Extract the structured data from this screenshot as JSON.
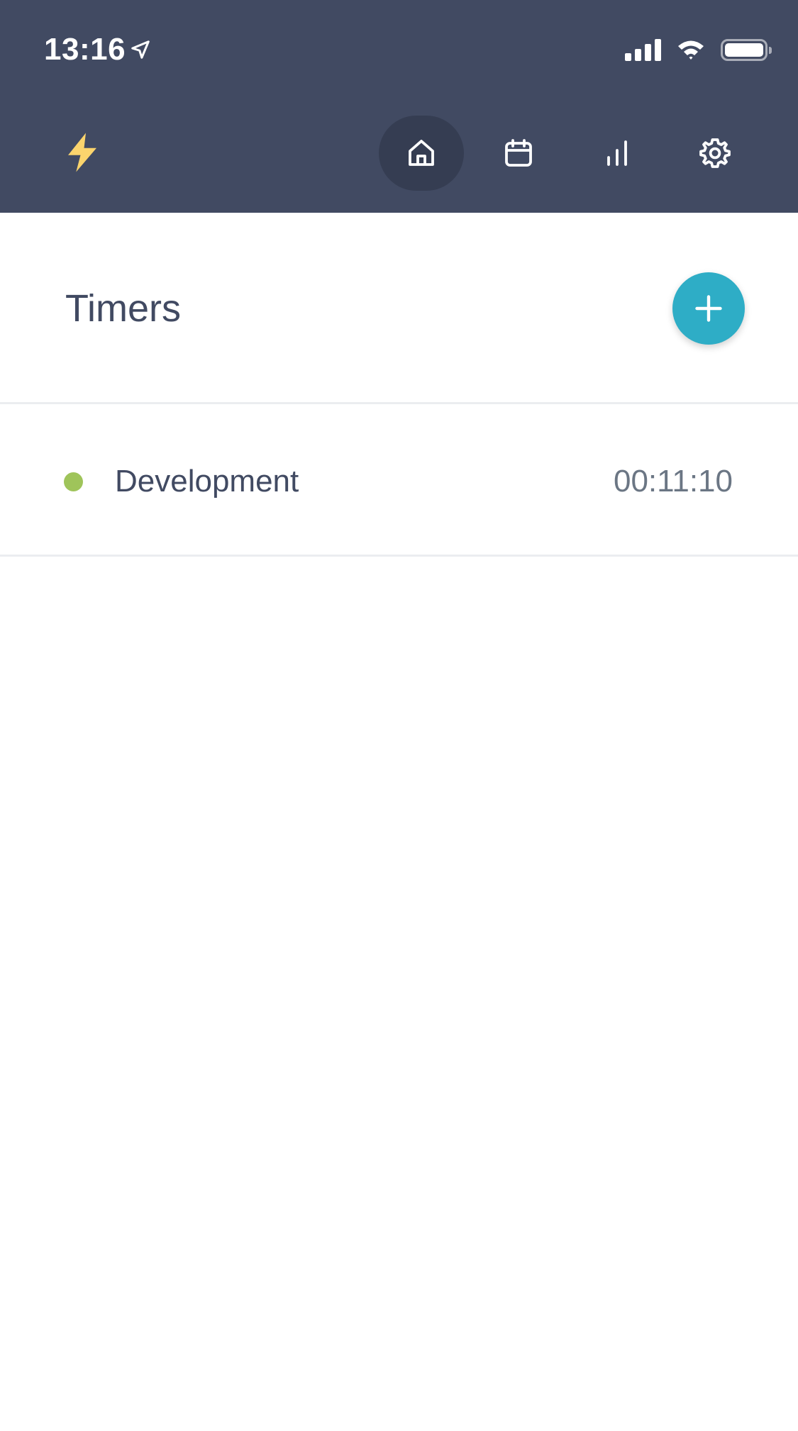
{
  "status_bar": {
    "time": "13:16",
    "location_icon": "location-arrow-icon",
    "signal_icon": "cellular-signal-icon",
    "wifi_icon": "wifi-icon",
    "battery_icon": "battery-icon"
  },
  "header": {
    "logo_icon": "lightning-bolt-icon",
    "tabs": [
      {
        "id": "home",
        "icon": "home-icon",
        "active": true
      },
      {
        "id": "calendar",
        "icon": "calendar-icon",
        "active": false
      },
      {
        "id": "stats",
        "icon": "bar-chart-icon",
        "active": false
      },
      {
        "id": "settings",
        "icon": "gear-icon",
        "active": false
      }
    ]
  },
  "main": {
    "title": "Timers",
    "add_button_icon": "plus-icon",
    "timers": [
      {
        "name": "Development",
        "duration": "00:11:10",
        "color": "#9fc45a"
      }
    ]
  },
  "colors": {
    "header_bg": "#414a62",
    "active_tab_bg": "#353d52",
    "accent": "#2eadc6",
    "logo": "#fbd46d",
    "text_primary": "#414a62",
    "text_secondary": "#6b7684",
    "divider": "#ebedf0"
  }
}
